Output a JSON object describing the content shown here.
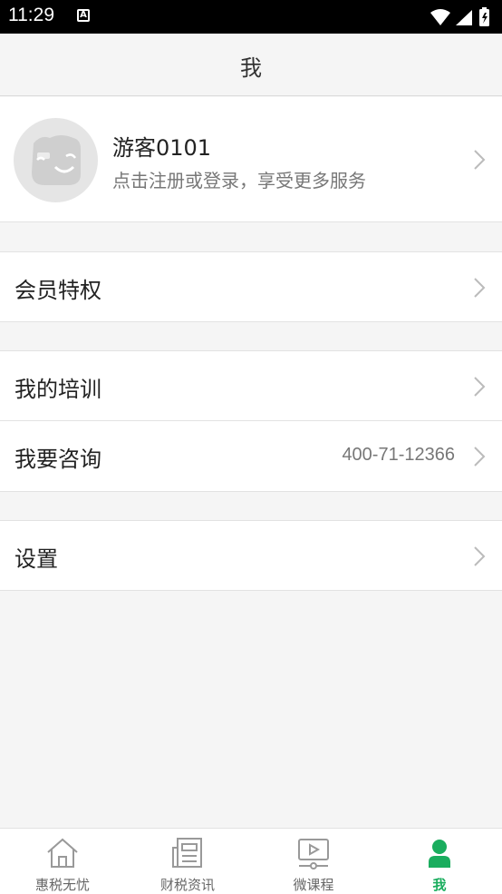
{
  "status_bar": {
    "time": "11:29",
    "notification_glyph": "A"
  },
  "header": {
    "title": "我"
  },
  "profile": {
    "name": "游客0101",
    "subtitle": "点击注册或登录，享受更多服务"
  },
  "menu": {
    "membership": {
      "label": "会员特权"
    },
    "training": {
      "label": "我的培训"
    },
    "consult": {
      "label": "我要咨询",
      "value": "400-71-12366"
    },
    "settings": {
      "label": "设置"
    }
  },
  "tabs": [
    {
      "label": "惠税无忧",
      "icon": "home-icon"
    },
    {
      "label": "财税资讯",
      "icon": "news-icon"
    },
    {
      "label": "微课程",
      "icon": "video-icon"
    },
    {
      "label": "我",
      "icon": "person-icon",
      "active": true
    }
  ],
  "colors": {
    "accent": "#1aad5e",
    "background": "#f5f5f5"
  }
}
